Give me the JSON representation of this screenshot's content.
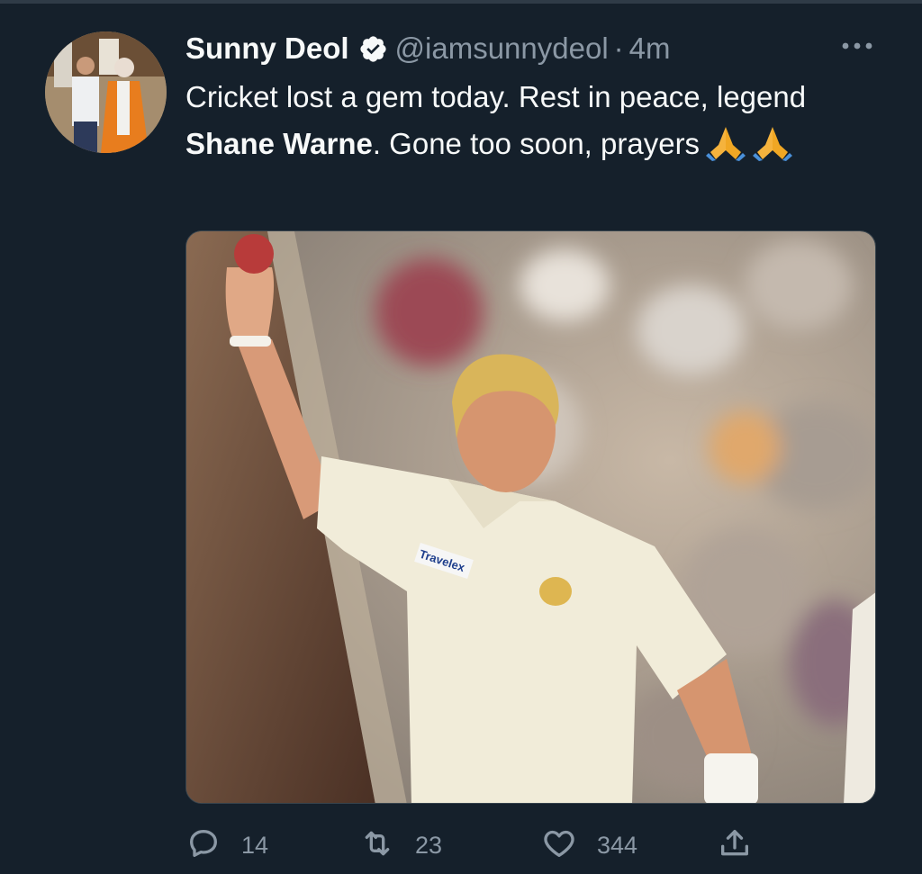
{
  "tweet": {
    "author_name": "Sunny Deol",
    "handle": "@iamsunnydeol",
    "separator": "·",
    "time": "4m",
    "text_part1": "Cricket lost a gem today. Rest in peace, legend ",
    "text_bold": "Shane Warne",
    "text_part2": ". Gone too soon, prayers",
    "emoji": "folded-hands x2",
    "verified_icon": "verified-badge-icon",
    "more_icon": "more-options-icon"
  },
  "media": {
    "description_icon": "photo",
    "jersey_sponsor": "Travelex"
  },
  "actions": {
    "reply_count": "14",
    "retweet_count": "23",
    "like_count": "344",
    "reply_icon": "reply-icon",
    "retweet_icon": "retweet-icon",
    "like_icon": "like-icon",
    "share_icon": "share-icon"
  },
  "colors": {
    "background": "#15202b",
    "text_primary": "#f7f9f9",
    "text_secondary": "#8b98a5"
  }
}
